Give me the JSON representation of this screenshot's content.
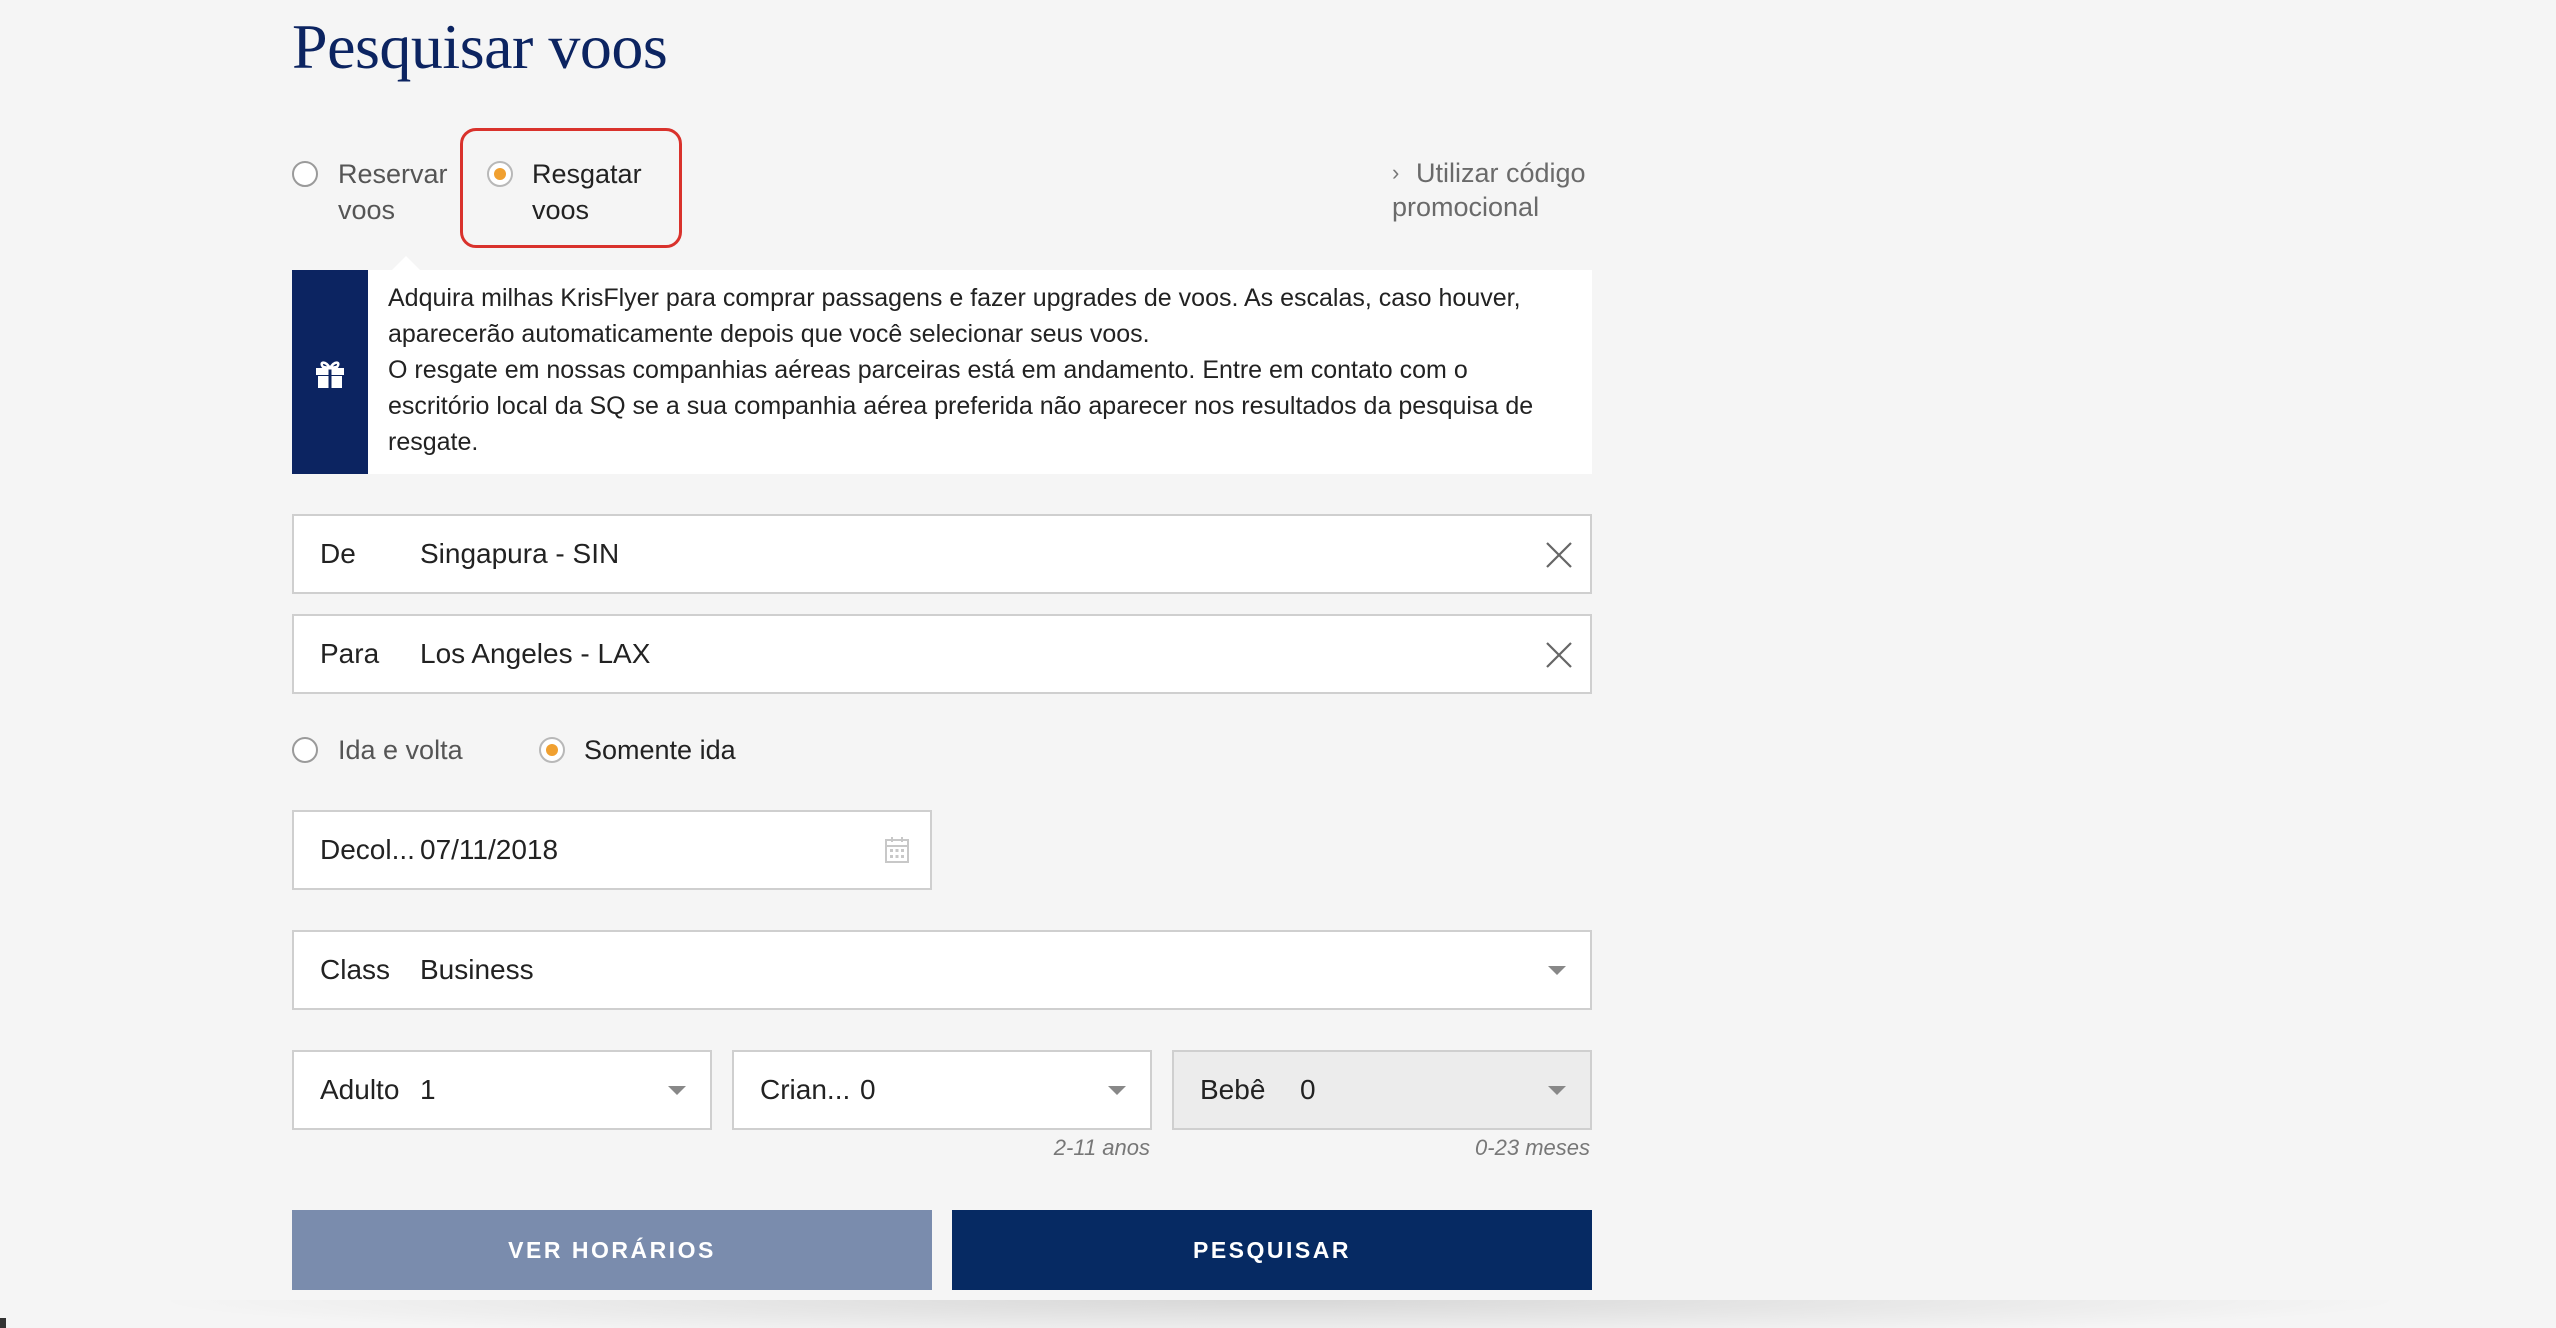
{
  "page": {
    "title": "Pesquisar voos"
  },
  "booking_type": {
    "options": [
      {
        "label_line1": "Reservar",
        "label_line2": "voos",
        "checked": false
      },
      {
        "label_line1": "Resgatar",
        "label_line2": "voos",
        "checked": true
      }
    ]
  },
  "promo": {
    "line1": "Utilizar código",
    "line2": "promocional",
    "icon": "chevron-right-icon"
  },
  "info": {
    "icon": "gift-icon",
    "paragraph1": "Adquira milhas KrisFlyer para comprar passagens e fazer upgrades de voos. As escalas, caso houver, aparecerão automaticamente depois que você selecionar seus voos.",
    "paragraph2": "O resgate em nossas companhias aéreas parceiras está em andamento. Entre em contato com o escritório local da SQ se a sua companhia aérea preferida não aparecer nos resultados da pesquisa de resgate."
  },
  "from": {
    "label": "De",
    "value": "Singapura - SIN"
  },
  "to": {
    "label": "Para",
    "value": "Los Angeles - LAX"
  },
  "trip_type": {
    "options": [
      {
        "label": "Ida e volta",
        "checked": false
      },
      {
        "label": "Somente ida",
        "checked": true
      }
    ]
  },
  "departure": {
    "label": "Decol...",
    "value": "07/11/2018"
  },
  "cabin_class": {
    "label": "Class",
    "value": "Business"
  },
  "passengers": {
    "adult": {
      "label": "Adulto",
      "value": "1"
    },
    "child": {
      "label": "Crian...",
      "value": "0",
      "hint": "2-11 anos"
    },
    "infant": {
      "label": "Bebê",
      "value": "0",
      "hint": "0-23 meses"
    }
  },
  "buttons": {
    "schedule": "VER HORÁRIOS",
    "search": "PESQUISAR"
  },
  "colors": {
    "brand_navy": "#0c2461",
    "button_primary": "#062a63",
    "button_secondary": "#7a8cad",
    "radio_accent": "#f0a030",
    "highlight": "#d9322c"
  }
}
